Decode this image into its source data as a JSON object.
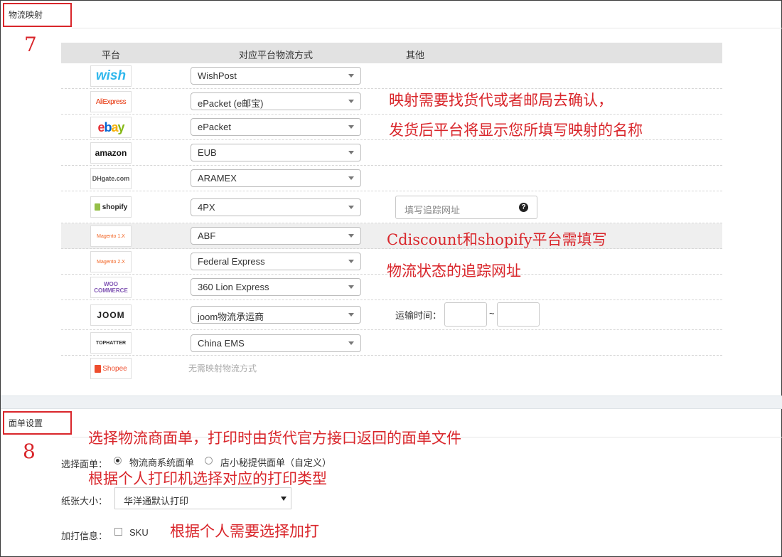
{
  "logistics_section": {
    "title": "物流映射",
    "step": "7",
    "columns": {
      "platform": "平台",
      "method": "对应平台物流方式",
      "other": "其他"
    },
    "rows": [
      {
        "platform": "wish",
        "logo_text": "wish",
        "method": "WishPost"
      },
      {
        "platform": "aliexpress",
        "logo_text": "AliExpress",
        "method": "ePacket (e邮宝)"
      },
      {
        "platform": "ebay",
        "logo_text": "ebay",
        "method": "ePacket"
      },
      {
        "platform": "amazon",
        "logo_text": "amazon",
        "method": "EUB"
      },
      {
        "platform": "dhgate",
        "logo_text": "DHgate.com",
        "method": "ARAMEX"
      },
      {
        "platform": "shopify",
        "logo_text": "shopify",
        "method": "4PX"
      },
      {
        "platform": "magento-1x",
        "logo_text": "Magento 1.X",
        "method": "ABF"
      },
      {
        "platform": "magento-2x",
        "logo_text": "Magento 2.X",
        "method": "Federal Express"
      },
      {
        "platform": "woocommerce",
        "logo_text": "WOO COMMERCE",
        "method": "360 Lion Express"
      },
      {
        "platform": "joom",
        "logo_text": "JOOM",
        "method": "joom物流承运商"
      },
      {
        "platform": "tophatter",
        "logo_text": "TOPHATTER",
        "method": "China EMS"
      },
      {
        "platform": "shopee",
        "logo_text": "Shopee",
        "method": ""
      }
    ],
    "shopee_note": "无需映射物流方式",
    "tracking_url_placeholder": "填写追踪网址",
    "shipping_time_label": "运输时间：",
    "shipping_time_sep": "~",
    "notes": {
      "mapping_line1": "映射需要找货代或者邮局去确认，",
      "mapping_line2": "发货后平台将显示您所填写映射的名称",
      "tracking_line1": "Cdiscount和shopify平台需填写",
      "tracking_line2": "物流状态的追踪网址"
    }
  },
  "label_section": {
    "title": "面单设置",
    "step": "8",
    "select_label_text": "选择面单：",
    "option_carrier": "物流商系统面单",
    "option_custom": "店小秘提供面单（自定义）",
    "paper_size_label": "纸张大小：",
    "paper_size_value": "华洋通默认打印",
    "extra_print_label": "加打信息：",
    "extra_sku": "SKU",
    "notes": {
      "label_note": "选择物流商面单，打印时由货代官方接口返回的面单文件",
      "printer_note": "根据个人打印机选择对应的打印类型",
      "extra_note": "根据个人需要选择加打"
    }
  },
  "colors": {
    "annotation_red": "#d9262b",
    "header_gray": "#e2e2e2",
    "wish_blue": "#2fb7ec",
    "shopify_green": "#95bf47",
    "shopee_orange": "#ee4d2d",
    "magento_orange": "#f26322"
  }
}
